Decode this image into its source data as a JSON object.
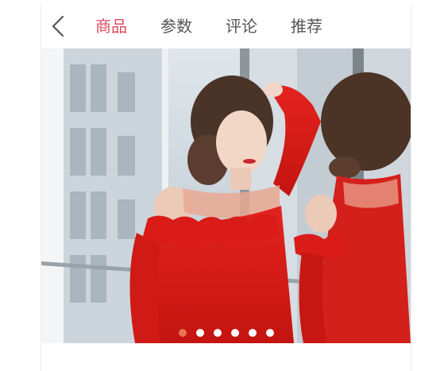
{
  "header": {
    "back_icon": "chevron-left-icon",
    "tabs": [
      {
        "label": "商品",
        "active": true
      },
      {
        "label": "参数",
        "active": false
      },
      {
        "label": "评论",
        "active": false
      },
      {
        "label": "推荐",
        "active": false
      }
    ]
  },
  "carousel": {
    "slide_count": 6,
    "active_index": 0
  },
  "colors": {
    "active_tab": "#e04a5f",
    "tab_text": "#555555",
    "dot_active": "#e8734f",
    "dot_inactive": "#ffffff"
  }
}
